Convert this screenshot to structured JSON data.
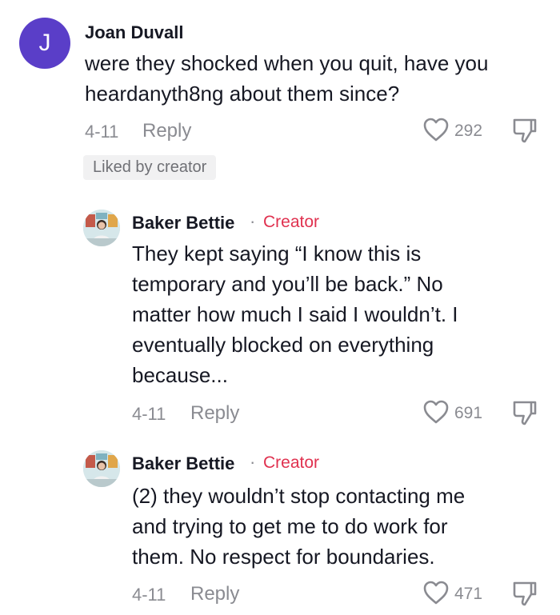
{
  "comments": [
    {
      "avatar_letter": "J",
      "username": "Joan Duvall",
      "lines": [
        "were they shocked when you quit, have you",
        "heardanyth8ng about them since?"
      ],
      "date": "4-11",
      "reply_label": "Reply",
      "like_count": "292",
      "liked_badge": "Liked by creator",
      "avatar_color": "#5a3ec8"
    },
    {
      "username": "Baker Bettie",
      "separator": "·",
      "creator_label": "Creator",
      "lines": [
        "They kept saying “I know this is",
        "temporary and you’ll be back.” No",
        "matter how much I said I wouldn’t. I",
        "eventually blocked on everything",
        "because..."
      ],
      "date": "4-11",
      "reply_label": "Reply",
      "like_count": "691"
    },
    {
      "username": "Baker Bettie",
      "separator": "·",
      "creator_label": "Creator",
      "lines": [
        "(2) they wouldn’t stop contacting me",
        "and trying to get me to do work for",
        "them. No respect for boundaries."
      ],
      "date": "4-11",
      "reply_label": "Reply",
      "like_count": "471"
    }
  ],
  "icons": {
    "like": "heart-outline-icon",
    "dislike": "thumbs-down-outline-icon"
  },
  "colors": {
    "creator_tag": "#e0314f",
    "muted_text": "#8a8b91",
    "avatar_j": "#5a3ec8"
  }
}
